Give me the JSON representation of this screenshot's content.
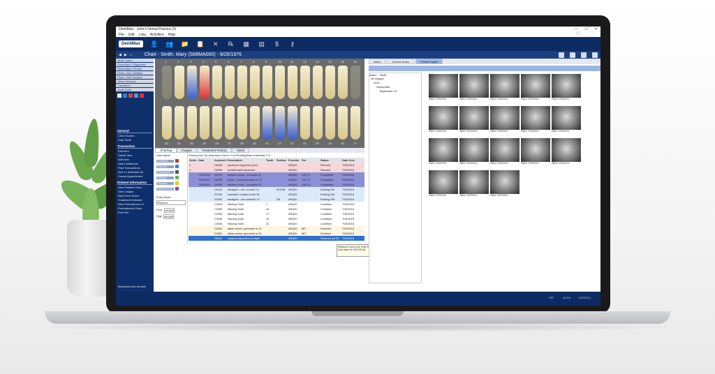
{
  "window": {
    "title": "DentiMax - John's Dental Practice 25"
  },
  "menu": [
    "File",
    "Edit",
    "Lists",
    "Activities",
    "Help"
  ],
  "toolbar": {
    "logo": "DentiMax",
    "icons": [
      "user-icon",
      "people-icon",
      "folder-icon",
      "notes-icon",
      "tools-icon",
      "rx-icon",
      "calendar-icon",
      "document-icon",
      "dollar-icon",
      "key-icon"
    ]
  },
  "chart_header": {
    "title": "Chart - Smith, Mary (SMIMA000) - 9/20/1976"
  },
  "leftnav": {
    "sections": [
      "Multi-Codes",
      "Preventive / Diagnostic",
      "Restorative / Prosth",
      "Exam / Adj / Multiple",
      "Perio / Oral Surgery",
      "Other Services",
      "Conditions",
      "Tooth Units"
    ],
    "general_header": "General",
    "general_items": [
      "Clinic Screen",
      "Hide Teeth"
    ],
    "transaction_header": "Transaction",
    "transaction_items": [
      "Edit Item",
      "Delete Item",
      "Add Item",
      "Add a Multicode",
      "Post Transactions",
      "Add Tx (Selected Ite",
      "Create Appointment"
    ],
    "related_header": "Related Information",
    "related_items": [
      "View Patient Inform",
      "View Ledger",
      "New Perio Exam",
      "Treatment Estimate",
      "New Pretreatment Cl",
      "Pretreatment Claim",
      "Print Rtx"
    ],
    "footer": "Bookmark this window"
  },
  "tooth_numbers_top": [
    "1",
    "2",
    "3",
    "4",
    "5",
    "6",
    "7",
    "8",
    "9",
    "10",
    "11",
    "12",
    "13",
    "14",
    "15",
    "16"
  ],
  "tooth_numbers_bottom": [
    "32",
    "31",
    "30",
    "29",
    "28",
    "27",
    "26",
    "25",
    "24",
    "23",
    "22",
    "21",
    "20",
    "19",
    "18",
    "17"
  ],
  "tabs": [
    "Charting",
    "Images",
    "Treatment Plan(s)",
    "Alerts"
  ],
  "view_mode": {
    "label": "View Mode",
    "modes": [
      "Condition",
      "Planned",
      "Completed",
      "Existing",
      "Declined",
      "Referred Out"
    ],
    "entry_mode_label": "Entry Mode",
    "entry_mode_value": "Planned",
    "prov_label": "Prov:",
    "prov_value": "ARQ00",
    "hyg_label": "Hyg:",
    "hyg_value": "ARQ00"
  },
  "table": {
    "info": "Primary Ins:   No Insurance                     Used + Ins Pending/Max Individual: 0.0",
    "headers": [
      "Order",
      "Date",
      "Account Code",
      "Description",
      "Tooth",
      "Surface",
      "Provider",
      "Fee",
      "Status",
      "Date Crea"
    ],
    "rows": [
      [
        "1",
        "",
        "D6056",
        "abutment supported porcl",
        "",
        "",
        "ARQ00",
        "",
        "Planned",
        "7/25/2018"
      ],
      [
        "2",
        "",
        "D6056",
        "prefabricated abutment",
        "",
        "",
        "ARQ00",
        "",
        "Planned",
        "7/25/2018"
      ],
      [
        "",
        "7/25/2018",
        "D6750",
        "retainer crown - porcelain 11",
        "",
        "",
        "ARQ00",
        "1347.5",
        "Completed",
        "7/25/2018"
      ],
      [
        "",
        "7/25/2018",
        "D6240",
        "pontic - porcelain fused to 12",
        "",
        "",
        "ARQ00",
        "1347.5",
        "Completed",
        "7/25/2018"
      ],
      [
        "",
        "7/25/2018",
        "D6750",
        "retainer crown - porcelain 13",
        "",
        "",
        "ARQ00",
        "1347.5",
        "Completed",
        "7/25/2018"
      ],
      [
        "",
        "",
        "D2140",
        "amalgam - four or more 12",
        "",
        "MODBL",
        "ARQ00",
        "",
        "Existing Ref",
        "7/25/2018"
      ],
      [
        "",
        "",
        "D7140",
        "extraction erupted tooth 18",
        "",
        "",
        "ARQ00",
        "",
        "Existing Ref",
        "7/25/2018"
      ],
      [
        "",
        "",
        "D2330",
        "amalgam - two surfaces 19",
        "",
        "DE",
        "ARQ00",
        "",
        "Existing Ref",
        "7/25/2018"
      ],
      [
        "",
        "",
        "C0006",
        "Missing Tooth",
        "1",
        "",
        "ARQ00",
        "",
        "Condition",
        "7/25/2018"
      ],
      [
        "",
        "",
        "C0006",
        "Missing Tooth",
        "16",
        "",
        "ARQ00",
        "",
        "Condition",
        "7/25/2018"
      ],
      [
        "",
        "",
        "C0006",
        "Missing Tooth",
        "17",
        "",
        "ARQ00",
        "",
        "Condition",
        "7/25/2018"
      ],
      [
        "",
        "",
        "C0006",
        "Missing Tooth",
        "18",
        "",
        "ARQ00",
        "",
        "Condition",
        "7/25/2018"
      ],
      [
        "",
        "",
        "C0006",
        "Missing Tooth",
        "32",
        "",
        "ARQ00",
        "",
        "Condition",
        "7/25/2018"
      ],
      [
        "",
        "",
        "D2962",
        "labial veneer (porcelain la 24",
        "",
        "",
        "ARQ00",
        "867",
        "Declined",
        "7/25/2018"
      ],
      [
        "",
        "",
        "D2962",
        "labial veneer (porcelain la 25",
        "",
        "",
        "ARQ00",
        "867",
        "Declined",
        "7/25/2018"
      ],
      [
        "",
        "",
        "D6010",
        "surgical placement of impl4",
        "",
        "",
        "ARQ00",
        "",
        "Referred out 02",
        "7/25/2018"
      ]
    ]
  },
  "tooltip": {
    "line1": "Referred Out to AZ Oral Surgery Center",
    "line2": "Due back on 8/22/2018"
  },
  "images_panel": {
    "tabs": [
      "Notes",
      "Clinical Notes",
      "X-Ray Images"
    ],
    "tree_tabs": [
      "Dates",
      "Teeth"
    ],
    "tree": [
      "All Images",
      "2014",
      "September",
      "September 19"
    ],
    "thumb_caption": "Taken: 9/19/2014"
  },
  "statusbar": {
    "left": "",
    "center": "DIR",
    "user": "ALIDA",
    "date": "10/2/2014"
  }
}
